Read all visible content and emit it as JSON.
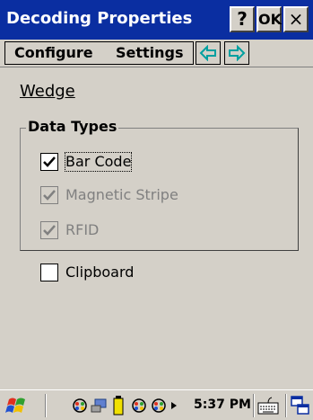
{
  "window": {
    "title": "Decoding Properties",
    "help_label": "?",
    "ok_label": "OK",
    "close_label": "×"
  },
  "tabs": [
    {
      "label": "Configure"
    },
    {
      "label": "Settings"
    }
  ],
  "nav": {
    "prev_icon": "left-arrow-icon",
    "next_icon": "right-arrow-icon"
  },
  "section": {
    "title": "Wedge"
  },
  "data_types": {
    "legend": "Data Types",
    "items": [
      {
        "label": "Bar Code",
        "checked": true,
        "enabled": true
      },
      {
        "label": "Magnetic Stripe",
        "checked": true,
        "enabled": false
      },
      {
        "label": "RFID",
        "checked": true,
        "enabled": false
      }
    ]
  },
  "clipboard": {
    "label": "Clipboard",
    "checked": false
  },
  "taskbar": {
    "time": "5:37 PM",
    "icons": [
      "start-icon",
      "network-icon",
      "connection-icon",
      "battery-icon",
      "app-icon",
      "app-icon-2",
      "tray-arrow-icon",
      "keyboard-icon",
      "task-switch-icon"
    ]
  },
  "colors": {
    "titlebar": "#0a2ea1",
    "face": "#d4d0c8",
    "arrow": "#00a0a0",
    "disabled_text": "#808080"
  }
}
